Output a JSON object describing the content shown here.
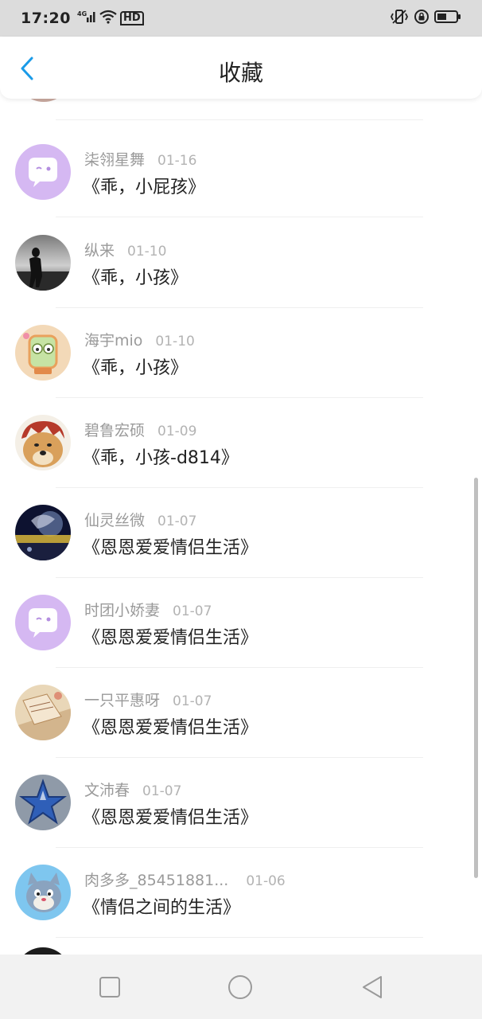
{
  "status_bar": {
    "time": "17:20",
    "network": "4G",
    "hd": "HD",
    "icons": [
      "signal-icon",
      "wifi-icon",
      "hd-icon",
      "vibrate-icon",
      "lock-rotation-icon",
      "battery-icon"
    ]
  },
  "header": {
    "title": "收藏",
    "back_icon": "chevron-left-icon",
    "accent": "#1a9be8"
  },
  "list": {
    "items": [
      {
        "name": "柒翎星舞",
        "date": "01-16",
        "title": "《乖，小屁孩》",
        "avatar": "default-chat-avatar"
      },
      {
        "name": "纵来",
        "date": "01-10",
        "title": "《乖，小孩》",
        "avatar": "photo-dark-figure"
      },
      {
        "name": "海宇mio",
        "date": "01-10",
        "title": "《乖，小孩》",
        "avatar": "cartoon-frog"
      },
      {
        "name": "碧鲁宏硕",
        "date": "01-09",
        "title": "《乖，小孩-d814》",
        "avatar": "doge-red-hair"
      },
      {
        "name": "仙灵丝微",
        "date": "01-07",
        "title": "《恩恩爱爱情侣生活》",
        "avatar": "night-photo"
      },
      {
        "name": "时团小娇妻",
        "date": "01-07",
        "title": "《恩恩爱爱情侣生活》",
        "avatar": "default-chat-avatar"
      },
      {
        "name": "一只平惠呀",
        "date": "01-07",
        "title": "《恩恩爱爱情侣生活》",
        "avatar": "paper-art"
      },
      {
        "name": "文沛春",
        "date": "01-07",
        "title": "《恩恩爱爱情侣生活》",
        "avatar": "blue-star"
      },
      {
        "name": "肉多多_85451881...",
        "date": "01-06",
        "title": "《情侣之间的生活》",
        "avatar": "cartoon-cat"
      }
    ]
  },
  "nav_bar": {
    "icons": [
      "recent-apps-icon",
      "home-icon",
      "back-icon"
    ]
  }
}
